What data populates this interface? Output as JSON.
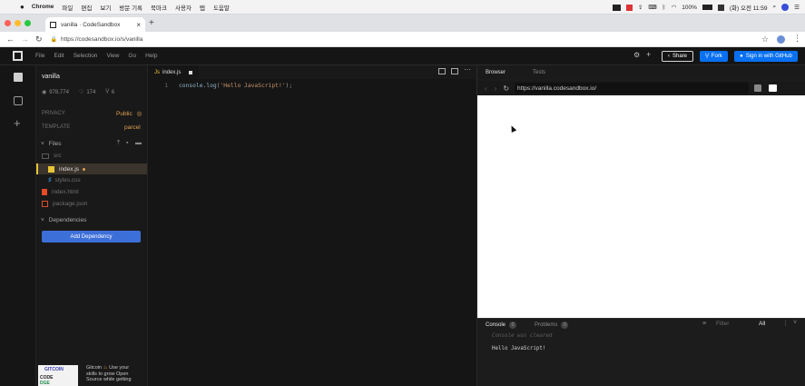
{
  "menubar": {
    "app": "Chrome",
    "items": [
      "파일",
      "편집",
      "보기",
      "방문 기록",
      "북마크",
      "사용자",
      "탭",
      "도움말"
    ],
    "battery": "100%",
    "clock": "(화) 오전 11:59"
  },
  "browser_tab": {
    "title": "vanilla · CodeSandbox",
    "close": "×",
    "new_tab": "+"
  },
  "address": {
    "url": "https://codesandbox.io/s/vanilla"
  },
  "app_menu": [
    "File",
    "Edit",
    "Selection",
    "View",
    "Go",
    "Help"
  ],
  "header_actions": {
    "share": "Share",
    "fork": "Fork",
    "signin": "Sign in with GitHub"
  },
  "sandbox": {
    "name": "vanilla",
    "views": "978,774",
    "likes": "174",
    "forks": "6",
    "privacy_label": "PRIVACY",
    "privacy_value": "Public",
    "template_label": "TEMPLATE",
    "template_value": "parcel"
  },
  "files": {
    "header": "Files",
    "items": [
      {
        "name": "src",
        "type": "folder"
      },
      {
        "name": "index.js",
        "type": "js",
        "active": true
      },
      {
        "name": "styles.css",
        "type": "css"
      },
      {
        "name": "index.html",
        "type": "html"
      },
      {
        "name": "package.json",
        "type": "json"
      }
    ]
  },
  "dependencies": {
    "header": "Dependencies",
    "add_button": "Add Dependency"
  },
  "ad": {
    "brand_line1": "GITCOIN",
    "brand_line2": "CODE",
    "brand_line3": "DGE",
    "text_title": "Gitcoin",
    "text_body_1": "Use your",
    "text_body_2": "skills to grow Open",
    "text_body_3": "Source while getting"
  },
  "editor": {
    "tab_label": "index.js",
    "line_number": "1",
    "code_fn": "console.log",
    "code_open": "(",
    "code_str": "'Hello JavaScript!'",
    "code_close": ");"
  },
  "preview": {
    "tabs": [
      "Browser",
      "Tests"
    ],
    "url": "https://vanilla.codesandbox.io/"
  },
  "console": {
    "tab_console": "Console",
    "console_count": "0",
    "tab_problems": "Problems",
    "problems_count": "0",
    "filter_placeholder": "Filter",
    "level": "All",
    "lines": [
      "Console was cleared",
      "Hello JavaScript!"
    ]
  },
  "colors": {
    "accent_blue": "#0971f1",
    "sidebar_active": "#3a342c",
    "js_yellow": "#e8c437",
    "html_red": "#e34c26",
    "css_blue": "#42a5f5"
  }
}
